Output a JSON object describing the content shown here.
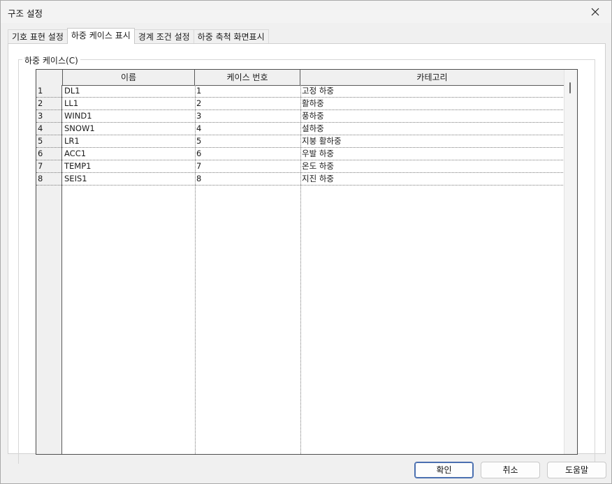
{
  "window": {
    "title": "구조 설정"
  },
  "tabs": [
    {
      "label": "기호 표현 설정",
      "active": false
    },
    {
      "label": "하중 케이스 표시",
      "active": true
    },
    {
      "label": "경계 조건 설정",
      "active": false
    },
    {
      "label": "하중 축척 화면표시",
      "active": false
    }
  ],
  "group": {
    "label": "하중 케이스(C)"
  },
  "grid": {
    "columns": [
      "이름",
      "케이스 번호",
      "카테고리"
    ],
    "rows": [
      {
        "idx": "1",
        "name": "DL1",
        "num": "1",
        "cat": "고정 하중"
      },
      {
        "idx": "2",
        "name": "LL1",
        "num": "2",
        "cat": "활하중"
      },
      {
        "idx": "3",
        "name": "WIND1",
        "num": "3",
        "cat": "풍하중"
      },
      {
        "idx": "4",
        "name": "SNOW1",
        "num": "4",
        "cat": "설하중"
      },
      {
        "idx": "5",
        "name": "LR1",
        "num": "5",
        "cat": "지붕 활하중"
      },
      {
        "idx": "6",
        "name": "ACC1",
        "num": "6",
        "cat": "우발 하중"
      },
      {
        "idx": "7",
        "name": "TEMP1",
        "num": "7",
        "cat": "온도 하중"
      },
      {
        "idx": "8",
        "name": "SEIS1",
        "num": "8",
        "cat": "지진 하중"
      }
    ]
  },
  "buttons": {
    "ok": "확인",
    "cancel": "취소",
    "help": "도움말"
  }
}
